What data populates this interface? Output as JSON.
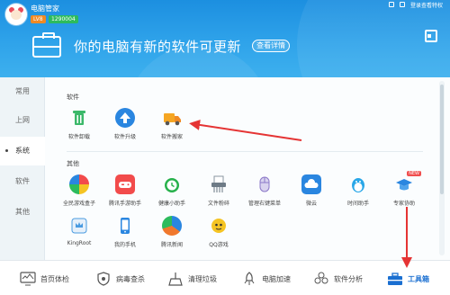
{
  "app": {
    "name": "电脑管家",
    "level": "LV8",
    "coins": "1290004"
  },
  "topbar": {
    "right_text": "登录查看特权"
  },
  "banner": {
    "headline": "你的电脑有新的软件可更新",
    "detail_button": "查看详情"
  },
  "sidebar": {
    "items": [
      {
        "label": "常用"
      },
      {
        "label": "上网"
      },
      {
        "label": "系统"
      },
      {
        "label": "软件"
      },
      {
        "label": "其他"
      }
    ]
  },
  "sections": {
    "software": {
      "title": "软件",
      "tools": [
        {
          "label": "软件卸载",
          "icon": "trash-icon",
          "color": "#3cb86a"
        },
        {
          "label": "软件升级",
          "icon": "upgrade-arrow-icon",
          "color": "#2a86e0"
        },
        {
          "label": "软件搬家",
          "icon": "truck-icon",
          "color": "#f5a623"
        }
      ]
    },
    "other": {
      "title": "其他",
      "tools": [
        {
          "label": "全民游戏盒子",
          "icon": "game-box-icon",
          "color": "#f28a22"
        },
        {
          "label": "腾讯手游助手",
          "icon": "gamepad-icon",
          "color": "#f24b4b"
        },
        {
          "label": "健康小助手",
          "icon": "alarm-clock-icon",
          "color": "#27b14b"
        },
        {
          "label": "文件粉碎",
          "icon": "shredder-icon",
          "color": "#6e7b86"
        },
        {
          "label": "管理右键菜单",
          "icon": "mouse-icon",
          "color": "#8b78c8"
        },
        {
          "label": "微云",
          "icon": "weiyun-cloud-icon",
          "color": "#2a86e0"
        },
        {
          "label": "时间助手",
          "icon": "penguin-clock-icon",
          "color": "#2aa7e8"
        },
        {
          "label": "专家协助",
          "icon": "graduation-cap-icon",
          "color": "#2a86e0"
        },
        {
          "label": "KingRoot",
          "icon": "kingroot-icon",
          "color": "#4a9be0"
        },
        {
          "label": "我的手机",
          "icon": "phone-icon",
          "color": "#2a86e0"
        },
        {
          "label": "腾讯新闻",
          "icon": "news-globe-icon",
          "color": "#f0782d"
        },
        {
          "label": "QQ游戏",
          "icon": "qq-game-icon",
          "color": "#f5c423"
        }
      ],
      "new_tag": "NEW"
    }
  },
  "bottom_nav": [
    {
      "label": "首页体检",
      "icon": "monitor-icon"
    },
    {
      "label": "病毒查杀",
      "icon": "shield-icon"
    },
    {
      "label": "清理垃圾",
      "icon": "broom-icon"
    },
    {
      "label": "电脑加速",
      "icon": "rocket-icon"
    },
    {
      "label": "软件分析",
      "icon": "software-flower-icon"
    },
    {
      "label": "工具箱",
      "icon": "toolbox-icon"
    }
  ],
  "colors": {
    "header": "#2fa3ea",
    "accent": "#1a6fd1",
    "annotation": "#e53434"
  }
}
